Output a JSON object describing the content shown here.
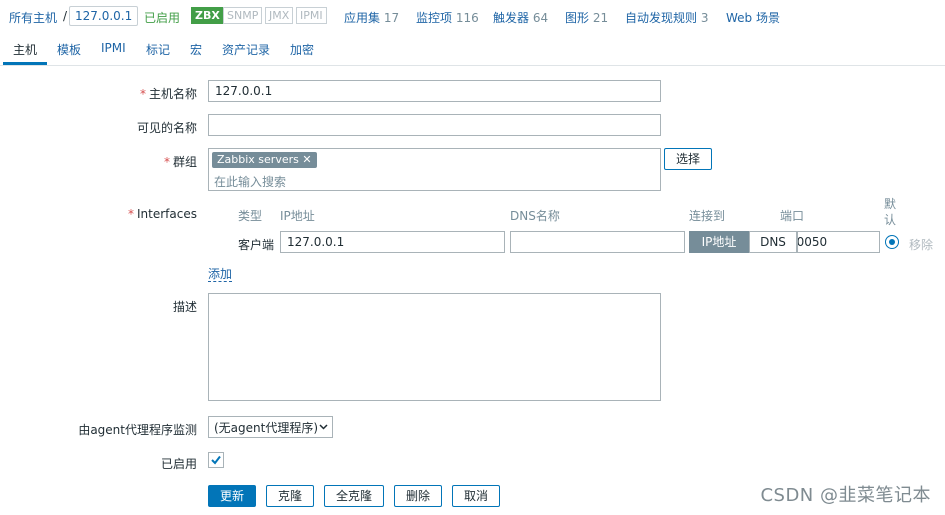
{
  "breadcrumb": {
    "all_hosts": "所有主机",
    "separator": "/",
    "current_host": "127.0.0.1",
    "status": "已启用",
    "badges": [
      "ZBX",
      "SNMP",
      "JMX",
      "IPMI"
    ],
    "links": [
      {
        "label": "应用集",
        "count": "17"
      },
      {
        "label": "监控项",
        "count": "116"
      },
      {
        "label": "触发器",
        "count": "64"
      },
      {
        "label": "图形",
        "count": "21"
      },
      {
        "label": "自动发现规则",
        "count": "3"
      },
      {
        "label": "Web 场景",
        "count": ""
      }
    ]
  },
  "tabs": [
    "主机",
    "模板",
    "IPMI",
    "标记",
    "宏",
    "资产记录",
    "加密"
  ],
  "form": {
    "hostname_label": "主机名称",
    "hostname_value": "127.0.0.1",
    "visible_name_label": "可见的名称",
    "visible_name_value": "",
    "groups_label": "群组",
    "group_chip": "Zabbix servers",
    "group_remove": "✕",
    "group_placeholder": "在此输入搜索",
    "select_button": "选择",
    "interfaces_label": "Interfaces",
    "interface_headers": {
      "type": "类型",
      "ip": "IP地址",
      "dns": "DNS名称",
      "connect_to": "连接到",
      "port": "端口",
      "default": "默认"
    },
    "interface_row": {
      "type": "客户端",
      "ip": "127.0.0.1",
      "dns": "",
      "connect_ip": "IP地址",
      "connect_dns": "DNS",
      "port": "10050",
      "remove": "移除"
    },
    "add_link": "添加",
    "description_label": "描述",
    "description_value": "",
    "proxy_label": "由agent代理程序监测",
    "proxy_value": "(无agent代理程序)",
    "enabled_label": "已启用",
    "enabled_checked": true
  },
  "buttons": {
    "update": "更新",
    "clone": "克隆",
    "full_clone": "全克隆",
    "delete": "删除",
    "cancel": "取消"
  },
  "colors": {
    "accent": "#0275b8",
    "link": "#1f65a6",
    "enabled": "#429e47",
    "required": "#d64e4e"
  },
  "watermark": "CSDN @韭菜笔记本"
}
